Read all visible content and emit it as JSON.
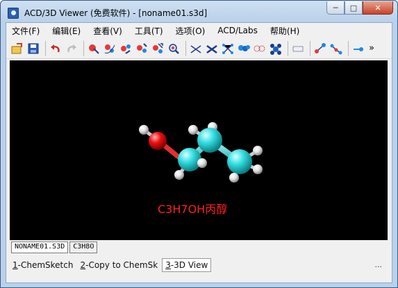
{
  "window": {
    "title": "ACD/3D Viewer (免费软件) - [noname01.s3d]",
    "buttons": {
      "minimize": "─",
      "maximize": "□",
      "close": "✕"
    }
  },
  "menu": [
    {
      "label": "文件(F)"
    },
    {
      "label": "编辑(E)"
    },
    {
      "label": "查看(V)"
    },
    {
      "label": "工具(T)"
    },
    {
      "label": "选项(O)"
    },
    {
      "label": "ACD/Labs"
    },
    {
      "label": "帮助(H)"
    }
  ],
  "toolbar": {
    "icons": [
      "open-icon",
      "save-icon",
      "undo-icon",
      "redo-icon",
      "select-atom-icon",
      "rotate-molecule-icon",
      "rotate-z-icon",
      "rotate-y-icon",
      "move-icon",
      "zoom-icon",
      "wireframe-icon",
      "sticks-icon",
      "ball-stick-icon",
      "spacefill-icon",
      "dots-icon",
      "spacefill-blue-icon",
      "dotted-surface-icon",
      "bond-length-icon",
      "bond-angle-icon",
      "label-toggle-icon"
    ],
    "more": "»"
  },
  "viewport": {
    "molecule_label": "C3H7OH丙醇",
    "colors": {
      "background": "#000000",
      "carbon": "#33dde0",
      "oxygen": "#ee1010",
      "hydrogen": "#e4e4e4",
      "label": "#ff2020"
    }
  },
  "doc_tabs": [
    {
      "label": "NONAME01.S3D"
    },
    {
      "label": "C3H8O"
    }
  ],
  "bottom_tabs": [
    {
      "num": "1",
      "label": "-ChemSketch"
    },
    {
      "num": "2",
      "label": "-Copy to ChemSk"
    },
    {
      "num": "3",
      "label": "-3D View"
    }
  ],
  "status": {
    "ellipsis": "..."
  }
}
